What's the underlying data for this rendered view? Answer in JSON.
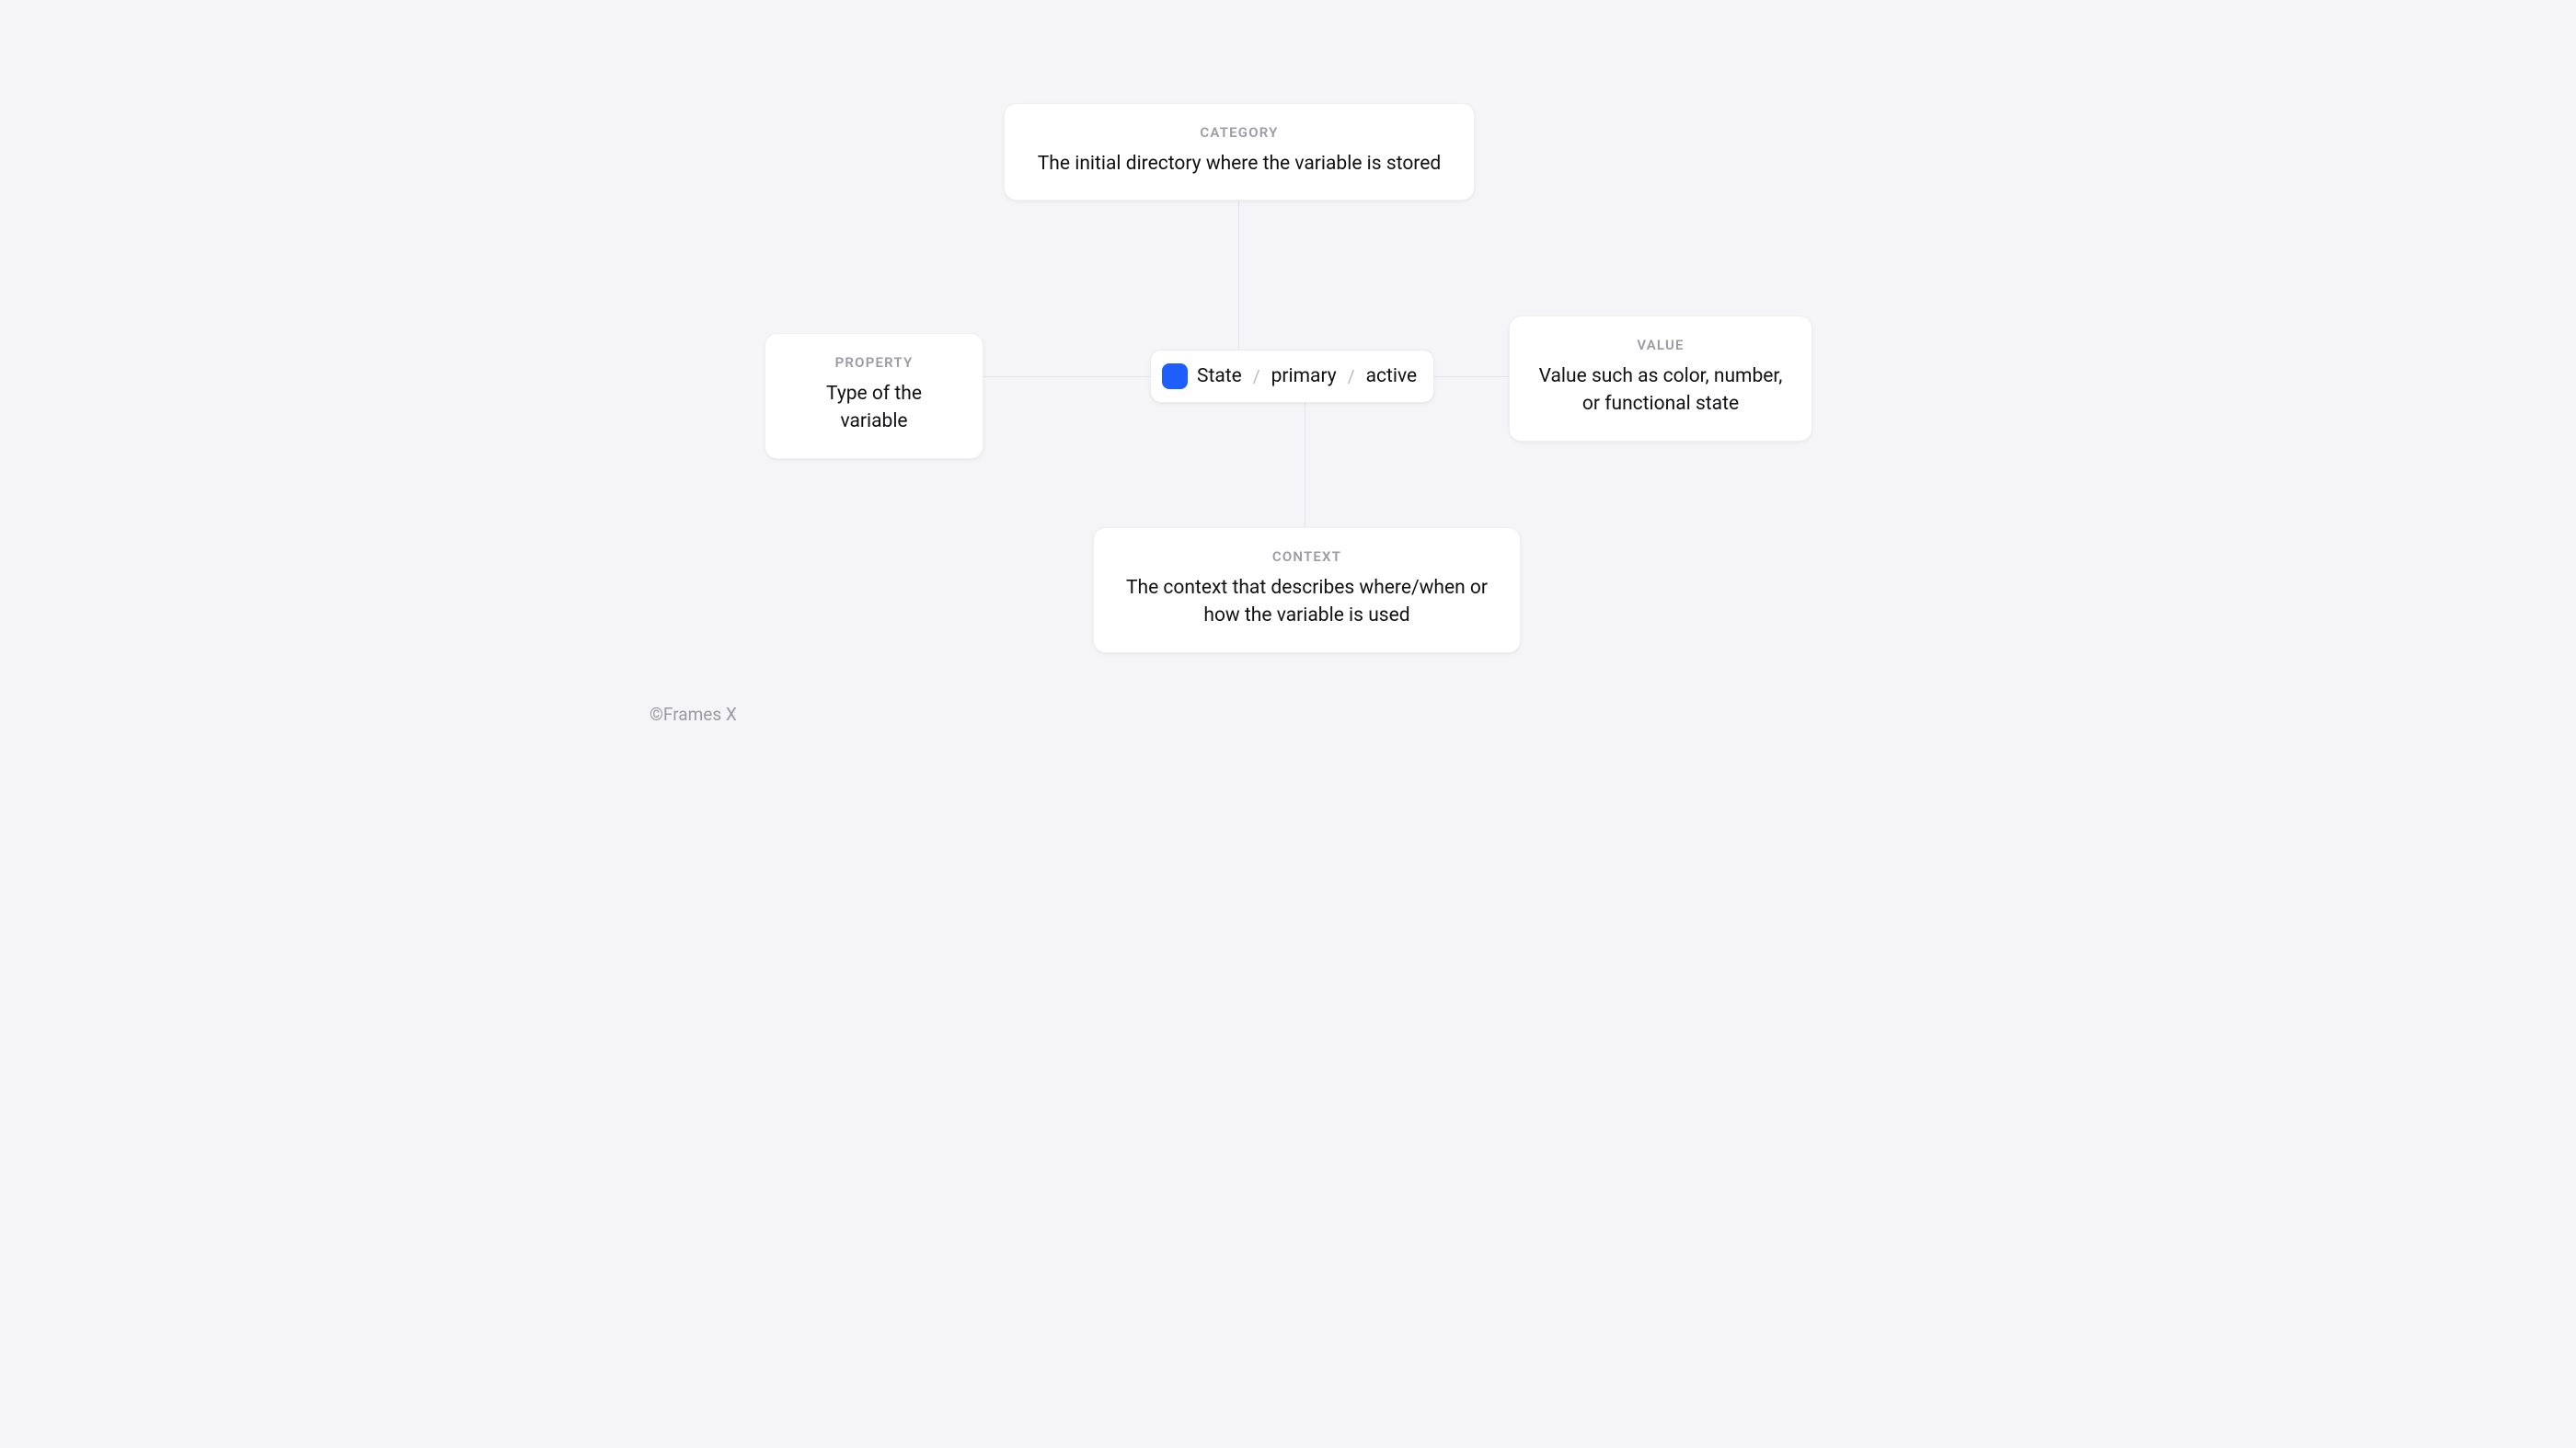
{
  "cards": {
    "category": {
      "label": "CATEGORY",
      "body": "The initial directory where the variable is stored"
    },
    "property": {
      "label": "PROPERTY",
      "body": "Type of the variable"
    },
    "value": {
      "label": "VALUE",
      "body": "Value such as color, number, or functional state"
    },
    "context": {
      "label": "CONTEXT",
      "body": "The context that describes where/when or how the variable is used"
    }
  },
  "pill": {
    "swatch_color": "#1e5eff",
    "segments": {
      "category": "State",
      "property": "primary",
      "value": "active"
    },
    "separator": "/"
  },
  "footer": "©Frames X"
}
